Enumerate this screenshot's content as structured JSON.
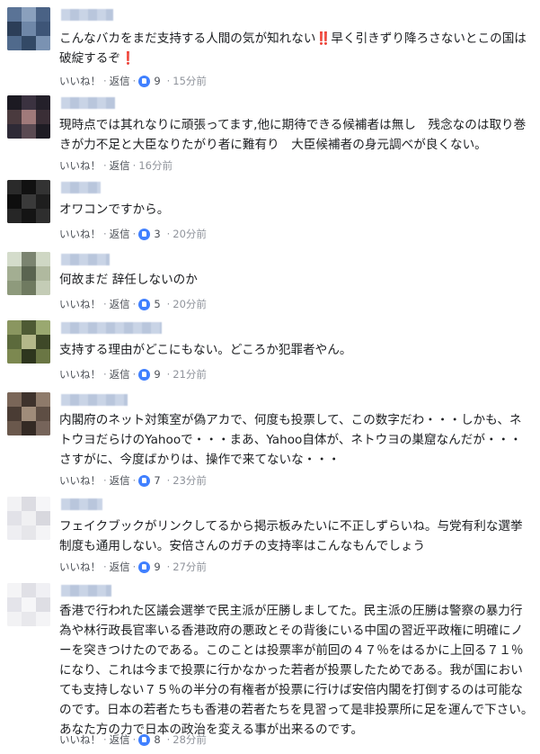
{
  "actions": {
    "like_label": "いいね！",
    "reply_label": "返信",
    "separator": "·"
  },
  "comments": [
    {
      "text_before": "こんなバカをまだ支持する人間の気が知れない",
      "emoji_1": "‼️",
      "text_middle": "早く引きずり降ろさないとこの国は破綻するぞ",
      "emoji_2": "❗",
      "likes": "9",
      "time": "15分前"
    },
    {
      "text": "現時点では其れなりに頑張ってます,他に期待できる候補者は無し　残念なのは取り巻きが力不足と大臣なりたがり者に難有り　大臣候補者の身元調べが良くない。",
      "time": "16分前"
    },
    {
      "text": "オワコンですから。",
      "likes": "3",
      "time": "20分前"
    },
    {
      "text": "何故まだ 辞任しないのか",
      "likes": "5",
      "time": "20分前"
    },
    {
      "text": "支持する理由がどこにもない。どころか犯罪者やん。",
      "likes": "9",
      "time": "21分前"
    },
    {
      "text": "内閣府のネット対策室が偽アカで、何度も投票して、この数字だわ・・・しかも、ネトウヨだらけのYahooで・・・まあ、Yahoo自体が、ネトウヨの巣窟なんだが・・・さすがに、今度ばかりは、操作で来てないな・・・",
      "likes": "7",
      "time": "23分前"
    },
    {
      "text": "フェイクブックがリンクしてるから掲示板みたいに不正しずらいね。与党有利な選挙制度も通用しない。安倍さんのガチの支持率はこんなもんでしょう",
      "likes": "9",
      "time": "27分前"
    },
    {
      "text": "香港で行われた区議会選挙で民主派が圧勝しましてた。民主派の圧勝は警察の暴力行為や林行政長官率いる香港政府の悪政とその背後にいる中国の習近平政権に明確にノーを突きつけたのである。このことは投票率が前回の４７％をはるかに上回る７１％になり、これは今まで投票に行かなかった若者が投票したためである。我が国においても支持しない７５％の半分の有権者が投票に行けば安倍内閣を打倒するのは可能なのです。日本の若者たちも香港の若者たちを見習って是非投票所に足を運んで下さい。あなた方の力で日本の政治を変える事が出来るのです。",
      "likes": "8",
      "time": "28分前"
    }
  ]
}
